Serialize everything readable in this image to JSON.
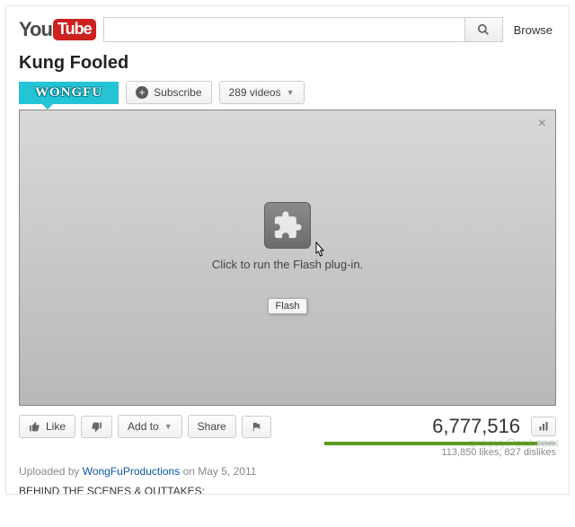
{
  "header": {
    "logo_you": "You",
    "logo_tube": "Tube",
    "search_placeholder": "",
    "browse": "Browse"
  },
  "video": {
    "title": "Kung Fooled",
    "channel_badge": "WONGFU",
    "subscribe": "Subscribe",
    "videos_count": "289 videos"
  },
  "player": {
    "plugin_text": "Click to run the Flash plug-in.",
    "tooltip": "Flash"
  },
  "actions": {
    "like": "Like",
    "addto": "Add to",
    "share": "Share"
  },
  "stats": {
    "views": "6,777,516",
    "likes_dislikes": "113,850 likes, 827 dislikes"
  },
  "meta": {
    "uploaded_prefix": "Uploaded by ",
    "uploader": "WongFuProductions",
    "uploaded_suffix": " on May 5, 2011",
    "description_line": "BEHIND THE SCENES & OUTTAKES:"
  },
  "watermark": "groovyPost.com"
}
